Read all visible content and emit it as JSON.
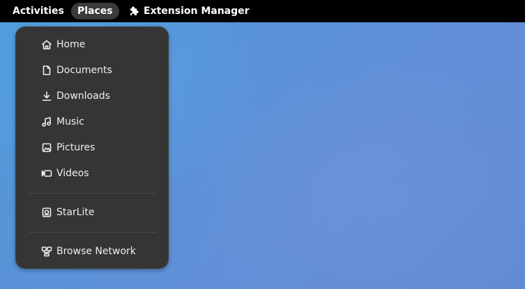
{
  "topbar": {
    "activities": "Activities",
    "places": "Places",
    "extension_manager": "Extension Manager"
  },
  "places_menu": {
    "items": [
      {
        "label": "Home",
        "icon": "home-icon"
      },
      {
        "label": "Documents",
        "icon": "document-icon"
      },
      {
        "label": "Downloads",
        "icon": "download-icon"
      },
      {
        "label": "Music",
        "icon": "music-icon"
      },
      {
        "label": "Pictures",
        "icon": "picture-icon"
      },
      {
        "label": "Videos",
        "icon": "video-icon"
      }
    ],
    "devices": [
      {
        "label": "StarLite",
        "icon": "drive-icon"
      }
    ],
    "network": [
      {
        "label": "Browse Network",
        "icon": "network-icon"
      }
    ]
  },
  "colors": {
    "topbar_bg": "#000000",
    "menu_bg": "#353535",
    "active_pill": "#3a3a3a",
    "desktop_blue": "#5a8fd4"
  }
}
